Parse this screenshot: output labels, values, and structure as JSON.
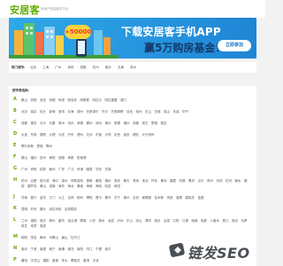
{
  "header": {
    "logo_text": "安居客",
    "slogan": "房地产信息服务平台"
  },
  "banner": {
    "coin_text": "+50000",
    "title": "下载安居客手机APP",
    "subtitle": "赢5万购房基金！",
    "cta": "立即参加"
  },
  "hot": {
    "label": "热门城市：",
    "cities": [
      "北京",
      "上海",
      "广州",
      "深圳",
      "成都",
      "杭州",
      "南京",
      "天津",
      "苏州"
    ]
  },
  "cities": {
    "title": "按字母选择：",
    "rows": [
      {
        "letter": "A",
        "items": [
          "鞍山",
          "安阳",
          "安庆",
          "安顺",
          "阿坝",
          "阿克苏",
          "阿勒泰",
          "阿拉尔",
          "阿拉善盟",
          "澳门"
        ]
      },
      {
        "letter": "B",
        "items": [
          "北京",
          "保定",
          "包头",
          "蚌埠",
          "宝鸡",
          "北海",
          "滨州",
          "巴彦淖尔",
          "巴中",
          "巴音郭楞",
          "百色",
          "亳州",
          "白山",
          "白城",
          "保山",
          "本溪",
          "毕节"
        ]
      },
      {
        "letter": "C",
        "items": [
          "成都",
          "重庆",
          "长沙",
          "长春",
          "常州",
          "沧州",
          "承德",
          "郴州",
          "池州",
          "滁州",
          "常德",
          "潮州",
          "赤峰",
          "崇左",
          "楚雄",
          "昌吉"
        ]
      },
      {
        "letter": "D",
        "items": [
          "大连",
          "东莞",
          "德阳",
          "大理",
          "大庆",
          "丹东",
          "德州",
          "达州",
          "东营",
          "大同",
          "定西",
          "迪庆",
          "德宏",
          "大兴安岭"
        ]
      },
      {
        "letter": "E",
        "items": [
          "鄂尔多斯",
          "恩施",
          "鄂州"
        ]
      },
      {
        "letter": "F",
        "items": [
          "佛山",
          "福州",
          "抚州",
          "阜阳",
          "抚顺",
          "阜新",
          "防城港"
        ]
      },
      {
        "letter": "G",
        "items": [
          "广州",
          "贵阳",
          "桂林",
          "赣州",
          "广安",
          "广元",
          "贵港",
          "固原",
          "甘孜",
          "甘南"
        ]
      },
      {
        "letter": "H",
        "items": [
          "杭州",
          "合肥",
          "哈尔滨",
          "海口",
          "惠州",
          "呼和浩特",
          "邯郸",
          "衡阳",
          "湖州",
          "淮安",
          "黄石",
          "菏泽",
          "淮北",
          "怀化",
          "黄冈",
          "鹤壁",
          "河源",
          "黑河",
          "汉中",
          "贺州",
          "河池",
          "红河",
          "衡水",
          "鹤岗",
          "葫芦岛",
          "黄山",
          "淮南",
          "海东",
          "海北",
          "黄南",
          "海南",
          "海西",
          "哈密",
          "和田"
        ]
      },
      {
        "letter": "J",
        "items": [
          "济南",
          "嘉兴",
          "金华",
          "江门",
          "九江",
          "吉林",
          "荆州",
          "揭阳",
          "晋中",
          "焦作",
          "济宁",
          "锦州",
          "吉安",
          "景德镇",
          "佳木斯",
          "鸡西",
          "酒泉",
          "嘉峪关",
          "金昌"
        ]
      },
      {
        "letter": "K",
        "items": [
          "昆明",
          "开封",
          "喀什",
          "克拉玛依",
          "克孜勒苏"
        ]
      },
      {
        "letter": "L",
        "items": [
          "兰州",
          "洛阳",
          "临沂",
          "柳州",
          "廊坊",
          "连云港",
          "聊城",
          "六安",
          "丽水",
          "龙岩",
          "泸州",
          "乐山",
          "凉山",
          "漯河",
          "临汾",
          "吕梁",
          "辽阳",
          "辽源",
          "陇南",
          "临夏",
          "六盘水",
          "丽江",
          "临沧",
          "拉萨",
          "林芝",
          "来宾",
          "娄底"
        ]
      },
      {
        "letter": "M",
        "items": [
          "绵阳",
          "茂名",
          "梅州",
          "马鞍山",
          "眉山",
          "牡丹江"
        ]
      },
      {
        "letter": "N",
        "items": [
          "南京",
          "宁波",
          "南昌",
          "南宁",
          "南通",
          "南充",
          "南阳",
          "内江",
          "宁德",
          "南平"
        ]
      },
      {
        "letter": "P",
        "items": [
          "莆田",
          "平顶山",
          "濮阳",
          "盘锦",
          "萍乡",
          "攀枝花",
          "普洱",
          "平凉"
        ]
      }
    ]
  },
  "watermark": {
    "text": "链发SEO"
  }
}
